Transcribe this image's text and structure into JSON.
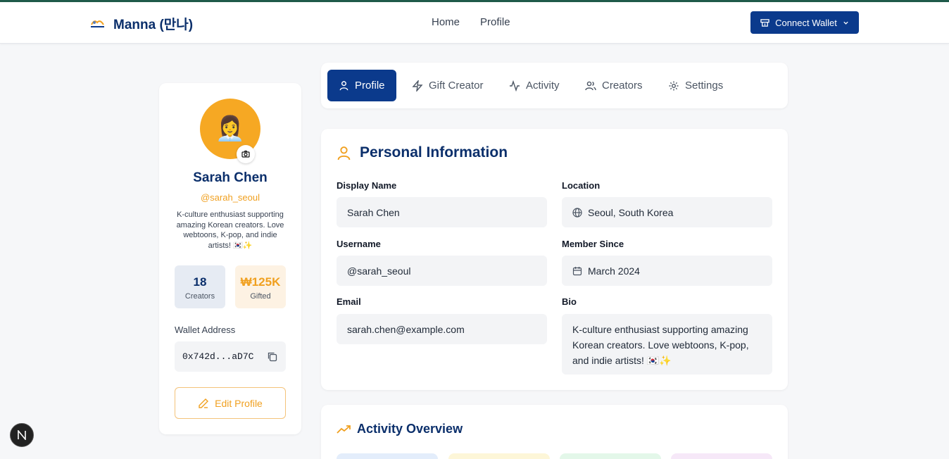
{
  "header": {
    "app_title": "Manna (만나)",
    "nav": [
      "Home",
      "Profile"
    ],
    "connect_wallet": "Connect Wallet"
  },
  "profile": {
    "avatar_emoji": "👩‍💼",
    "name": "Sarah Chen",
    "handle": "@sarah_seoul",
    "bio": "K-culture enthusiast supporting amazing Korean creators. Love webtoons, K-pop, and indie artists! 🇰🇷✨",
    "stats": [
      {
        "value": "18",
        "label": "Creators"
      },
      {
        "value": "₩125K",
        "label": "Gifted"
      }
    ],
    "wallet_label": "Wallet Address",
    "wallet_address": "0x742d...aD7C",
    "edit_button": "Edit Profile"
  },
  "tabs": [
    {
      "label": "Profile",
      "icon": "user-icon",
      "active": true
    },
    {
      "label": "Gift Creator",
      "icon": "zap-icon",
      "active": false
    },
    {
      "label": "Activity",
      "icon": "activity-icon",
      "active": false
    },
    {
      "label": "Creators",
      "icon": "users-icon",
      "active": false
    },
    {
      "label": "Settings",
      "icon": "gear-icon",
      "active": false
    }
  ],
  "personal_info": {
    "title": "Personal Information",
    "display_name_label": "Display Name",
    "display_name": "Sarah Chen",
    "username_label": "Username",
    "username": "@sarah_seoul",
    "email_label": "Email",
    "email": "sarah.chen@example.com",
    "location_label": "Location",
    "location": "Seoul, South Korea",
    "member_since_label": "Member Since",
    "member_since": "March 2024",
    "bio_label": "Bio",
    "bio": "K-culture enthusiast supporting amazing Korean creators. Love webtoons, K-pop, and indie artists! 🇰🇷✨"
  },
  "activity_overview": {
    "title": "Activity Overview"
  },
  "colors": {
    "brand_navy": "#0b3a8c",
    "accent_orange": "#f0a020"
  }
}
